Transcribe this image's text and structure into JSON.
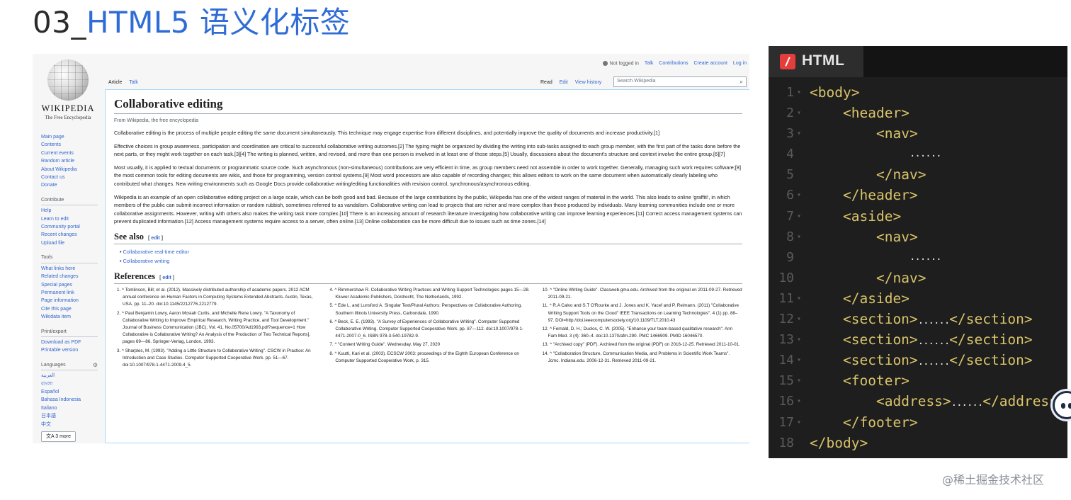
{
  "slide": {
    "title_num": "03_",
    "title_text": "HTML5 语义化标签"
  },
  "wiki": {
    "logo_word": "WIKIPEDIA",
    "logo_tagline": "The Free Encyclopedia",
    "userbar": {
      "not_logged": "Not logged in",
      "links": [
        "Talk",
        "Contributions",
        "Create account",
        "Log in"
      ]
    },
    "tabs_left": [
      "Article",
      "Talk"
    ],
    "tabs_right": [
      "Read",
      "Edit",
      "View history"
    ],
    "search_placeholder": "Search Wikipedia",
    "sidebar": {
      "main": [
        "Main page",
        "Contents",
        "Current events",
        "Random article",
        "About Wikipedia",
        "Contact us",
        "Donate"
      ],
      "contribute_head": "Contribute",
      "contribute": [
        "Help",
        "Learn to edit",
        "Community portal",
        "Recent changes",
        "Upload file"
      ],
      "tools_head": "Tools",
      "tools": [
        "What links here",
        "Related changes",
        "Special pages",
        "Permanent link",
        "Page information",
        "Cite this page",
        "Wikidata item"
      ],
      "print_head": "Print/export",
      "print": [
        "Download as PDF",
        "Printable version"
      ],
      "languages_head": "Languages",
      "languages": [
        "العربية",
        "বাংলা",
        "Español",
        "Bahasa Indonesia",
        "Italiano",
        "日本語",
        "中文"
      ],
      "more_label": "3 more"
    },
    "article": {
      "title": "Collaborative editing",
      "from": "From Wikipedia, the free encyclopedia",
      "p1": "Collaborative editing is the process of multiple people editing the same document simultaneously. This technique may engage expertise from different disciplines, and potentially improve the quality of documents and increase productivity.[1]",
      "p2": "Effective choices in group awareness, participation and coordination are critical to successful collaborative writing outcomes.[2] The typing might be organized by dividing the writing into sub-tasks assigned to each group member, with the first part of the tasks done before the next parts, or they might work together on each task.[3][4] The writing is planned, written, and revised, and more than one person is involved in at least one of those steps.[5] Usually, discussions about the document's structure and context involve the entire group.[6][7]",
      "p3": "Most usually, it is applied to textual documents or programmatic source code. Such asynchronous (non-simultaneous) contributions are very efficient in time, as group members need not assemble in order to work together. Generally, managing such work requires software;[8] the most common tools for editing documents are wikis, and those for programming, version control systems.[9] Most word processors are also capable of recording changes; this allows editors to work on the same document when automatically clearly labeling who contributed what changes. New writing environments such as Google Docs provide collaborative writing/editing functionalities with revision control, synchronous/asynchronous editing.",
      "p4": "Wikipedia is an example of an open collaborative editing project on a large scale, which can be both good and bad. Because of the large contributions by the public, Wikipedia has one of the widest ranges of material in the world. This also leads to online 'graffiti', in which members of the public can submit incorrect information or random rubbish, sometimes referred to as vandalism. Collaborative writing can lead to projects that are richer and more complex than those produced by individuals. Many learning communities include one or more collaborative assignments. However, writing with others also makes the writing task more complex.[10] There is an increasing amount of research literature investigating how collaborative writing can improve learning experiences.[11] Correct access management systems can prevent duplicated information.[12] Access management systems require access to a server, often online.[13] Online collaboration can be more difficult due to issues such as time zones.[14]",
      "see_also_head": "See also",
      "edit_label": "edit",
      "see_also": [
        "Collaborative real-time editor",
        "Collaborative writing"
      ],
      "refs_head": "References",
      "refs_col1": [
        "1. ^ Tomlinson, Bill; et al. (2012). Massively distributed authorship of academic papers. 2012 ACM annual conference on Human Factors in Computing Systems Extended Abstracts. Austin, Texas, USA. pp. 11–20. doi:10.1145/2212776.2212779.",
        "2. ^ Paul Benjamin Lowry, Aaron Mosiah Curtis, and Michelle Rene Lowry. \"A Taxonomy of Collaborative Writing to Improve Empirical Research, Writing Practice, and Tool Development.\" Journal of Business Communication (JBC), Vol. 41, No.05700/Ad1993.pdf?sequence=1 How Collaborative is Collaborative Writing? An Analysis of the Production of Two Technical Reports], pages 69—86. Springer-Verlag, London, 1993.",
        "3. ^ Sharples, M. (1993). \"Adding a Little Structure to Collaborative Writing\". CSCW in Practice: An Introduction and Case Studies. Computer Supported Cooperative Work. pp. 51—67. doi:10.1007/978-1-4471-2009-4_5."
      ],
      "refs_col2": [
        "4. ^ Rimmershaw R. Collaborative Writing Practices and Writing Support Technologies pages 15—28. Kluwer Academic Publishers, Dordrecht, The Netherlands, 1992.",
        "5. ^ Ede L. and Lunsford A. Singular Text/Plural Authors: Perspectives on Collaborative Authoring. Southern Illinois University Press, Carbondale, 1990.",
        "6. ^ Beck, E. E. (1993). \"A Survey of Experiences of Collaborative Writing\". Computer Supported Collaborative Writing. Computer Supported Cooperative Work. pp. 87—112. doi:10.1007/978-1-4471-2007-0_6. ISBN 978-3-540-19782-9.",
        "7. ^ \"Content Writing Guide\". Wednesday, May 27, 2020",
        "8. ^ Kuutti, Kari et al. (2003). ECSCW 2003: proceedings of the Eighth European Conference on Computer Supported Cooperative Work, p. 315."
      ],
      "refs_col3": [
        "10. ^ \"Online Writing Guide\". Classweb.gmu.edu. Archived from the original on 2011-09-27. Retrieved 2011-09-21.",
        "11. ^ R.A Calvo and S.T O'Rourke and J. Jones and K. Yacef and P. Reimann. (2011) \"Collaborative Writing Support Tools on the Cloud\" IEEE Transactions on Learning Technologies\". 4 (1) pp. 88–97. DOI=http://doi.ieeecomputersociety.org/10.1109/TLT.2010.43",
        "12. ^ Fernald, D. H.; Duclos, C. W. (2005). \"Enhance your team-based qualitative research\". Ann Fam Med. 3 (4): 360–4. doi:10.1370/afm.290. PMC 1466909. PMID 16046570.",
        "13. ^ \"Archived copy\" (PDF). Archived from the original (PDF) on 2016-12-25. Retrieved 2011-10-01.",
        "14. ^ \"Collaboration Structure, Communication Media, and Problems in Scientific Work Teams\". Jcmc. Indiana.edu. 2006-12-31. Retrieved 2011-09-21."
      ]
    }
  },
  "code": {
    "tab_label": "HTML",
    "lines": [
      {
        "n": "1",
        "t": "<body>",
        "indent": 0
      },
      {
        "n": "2",
        "t": "<header>",
        "indent": 1
      },
      {
        "n": "3",
        "t": "<nav>",
        "indent": 2
      },
      {
        "n": "4",
        "t": "......",
        "indent": 3
      },
      {
        "n": "5",
        "t": "</nav>",
        "indent": 2
      },
      {
        "n": "6",
        "t": "</header>",
        "indent": 1
      },
      {
        "n": "7",
        "t": "<aside>",
        "indent": 1
      },
      {
        "n": "8",
        "t": "<nav>",
        "indent": 2
      },
      {
        "n": "9",
        "t": "......",
        "indent": 3
      },
      {
        "n": "10",
        "t": "</nav>",
        "indent": 2
      },
      {
        "n": "11",
        "t": "</aside>",
        "indent": 1
      },
      {
        "n": "12",
        "t": "<section>......</section>",
        "indent": 1
      },
      {
        "n": "13",
        "t": "<section>......</section>",
        "indent": 1
      },
      {
        "n": "14",
        "t": "<section>......</section>",
        "indent": 1
      },
      {
        "n": "15",
        "t": "<footer>",
        "indent": 1
      },
      {
        "n": "16",
        "t": "<address>......</address>",
        "indent": 2
      },
      {
        "n": "17",
        "t": "</footer>",
        "indent": 1
      },
      {
        "n": "18",
        "t": "</body>",
        "indent": 0
      }
    ]
  },
  "watermark": "@稀土掘金技术社区",
  "colors": {
    "title_blue": "#2f6cd6",
    "wiki_link": "#3366cc",
    "code_bg": "#1e1e1e",
    "code_tag": "#d9c36a",
    "html_icon": "#e43d3b"
  }
}
